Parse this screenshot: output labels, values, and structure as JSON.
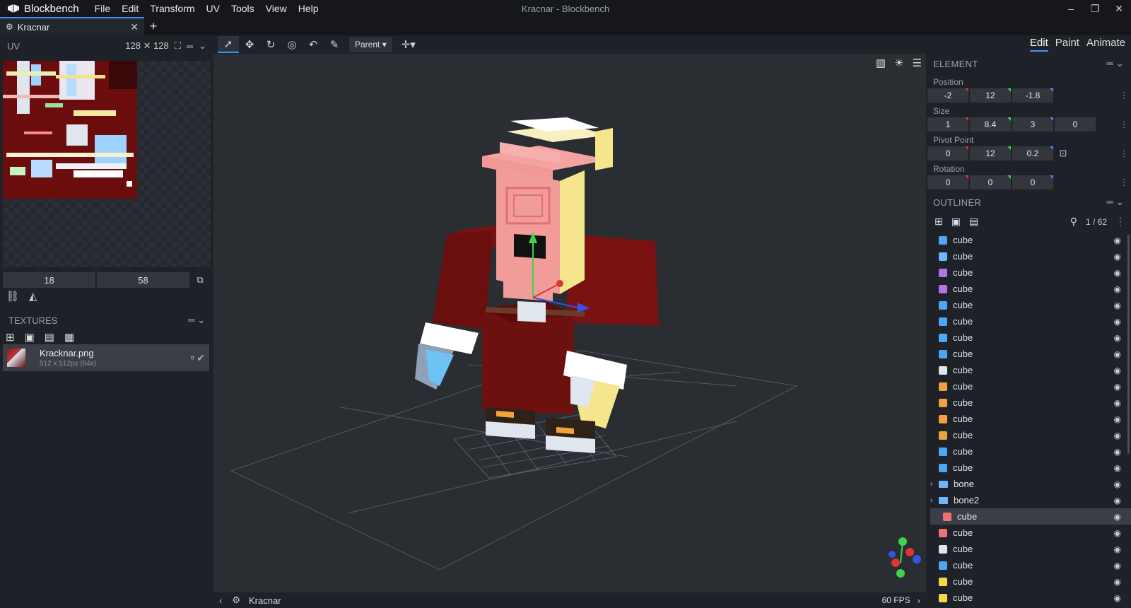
{
  "app": {
    "name": "Blockbench",
    "window_title": "Kracnar - Blockbench"
  },
  "menu": [
    "File",
    "Edit",
    "Transform",
    "UV",
    "Tools",
    "View",
    "Help"
  ],
  "tab": {
    "label": "Kracnar"
  },
  "uv": {
    "title": "UV",
    "size": "128 ✕ 128",
    "field1": "18",
    "field2": "58"
  },
  "textures": {
    "title": "TEXTURES",
    "item": {
      "name": "Kracknar.png",
      "info": "512 x 512px (64x)"
    }
  },
  "toolbar": {
    "pivot_mode": "Parent"
  },
  "modes": {
    "edit": "Edit",
    "paint": "Paint",
    "animate": "Animate"
  },
  "element": {
    "title": "ELEMENT",
    "position_label": "Position",
    "position": [
      "-2",
      "12",
      "-1.8"
    ],
    "size_label": "Size",
    "size": [
      "1",
      "8.4",
      "3",
      "0"
    ],
    "pivot_label": "Pivot Point",
    "pivot": [
      "0",
      "12",
      "0.2"
    ],
    "rotation_label": "Rotation",
    "rotation": [
      "0",
      "0",
      "0"
    ]
  },
  "outliner": {
    "title": "OUTLINER",
    "count": "1 / 62",
    "items": [
      {
        "label": "cube",
        "type": "cube",
        "color": "#4ea6f5"
      },
      {
        "label": "cube",
        "type": "cube",
        "color": "#6db7ff"
      },
      {
        "label": "cube",
        "type": "cube",
        "color": "#b075e8"
      },
      {
        "label": "cube",
        "type": "cube",
        "color": "#b075e8"
      },
      {
        "label": "cube",
        "type": "cube",
        "color": "#4ea6f5"
      },
      {
        "label": "cube",
        "type": "cube",
        "color": "#4ea6f5"
      },
      {
        "label": "cube",
        "type": "cube",
        "color": "#4ea6f5"
      },
      {
        "label": "cube",
        "type": "cube",
        "color": "#4ea6f5"
      },
      {
        "label": "cube",
        "type": "cube",
        "color": "#dfe4ea"
      },
      {
        "label": "cube",
        "type": "cube",
        "color": "#f0a23c"
      },
      {
        "label": "cube",
        "type": "cube",
        "color": "#f0a23c"
      },
      {
        "label": "cube",
        "type": "cube",
        "color": "#f0a23c"
      },
      {
        "label": "cube",
        "type": "cube",
        "color": "#f0a23c"
      },
      {
        "label": "cube",
        "type": "cube",
        "color": "#4ea6f5"
      },
      {
        "label": "cube",
        "type": "cube",
        "color": "#4ea6f5"
      },
      {
        "label": "bone",
        "type": "folder",
        "color": "#6db7ff"
      },
      {
        "label": "bone2",
        "type": "folder",
        "color": "#6db7ff"
      },
      {
        "label": "cube",
        "type": "cube",
        "color": "#f07272"
      },
      {
        "label": "cube",
        "type": "cube",
        "color": "#f07272"
      },
      {
        "label": "cube",
        "type": "cube",
        "color": "#dfe4ea"
      },
      {
        "label": "cube",
        "type": "cube",
        "color": "#4ea6f5"
      },
      {
        "label": "cube",
        "type": "cube",
        "color": "#f5d64a"
      },
      {
        "label": "cube",
        "type": "cube",
        "color": "#f5d64a"
      }
    ]
  },
  "status": {
    "project": "Kracnar",
    "fps": "60 FPS"
  }
}
